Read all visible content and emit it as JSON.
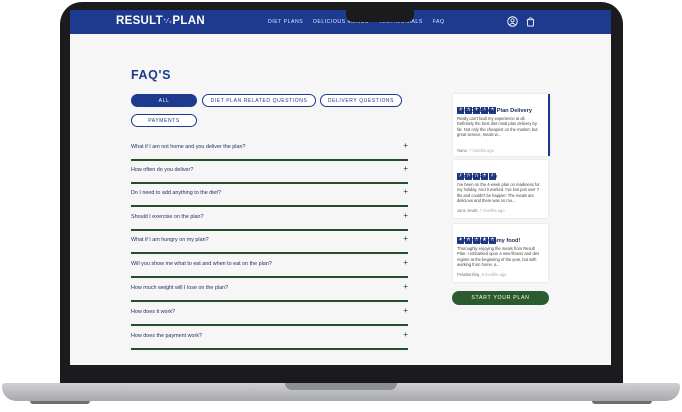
{
  "brand": {
    "logo_left": "RESULT",
    "logo_sep": "⁺⁄₊",
    "logo_right": "PLAN"
  },
  "nav": {
    "links": [
      "DIET PLANS",
      "DELICIOUS MENUS",
      "TESTIMONIALS",
      "FAQ"
    ]
  },
  "page": {
    "title": "FAQ'S"
  },
  "filters": [
    "ALL",
    "DIET PLAN RELATED QUESTIONS",
    "DELIVERY QUESTIONS",
    "PAYMENTS"
  ],
  "faqs": [
    "What if I am not home and you deliver the plan?",
    "How often do you deliver?",
    "Do I need to add anything to the diet?",
    "Should I exercise on the plan?",
    "What if I am hungry on my plan?",
    "Will you show me what to eat and when to eat on the plan?",
    "How much weight will I lose on the plan?",
    "How does it work?",
    "How does the payment work?"
  ],
  "faq_expand_symbol": "+",
  "reviews": [
    {
      "stars": "★",
      "rating": 5,
      "title": "Best Diet Meal Plan Delivery",
      "text": "Really can't fault my experience at all. Definitely the best diet meal plan delivery by far. Not only the cheapest on the market, but great service, meals w...",
      "author": "Nana",
      "ago": "7 months ago"
    },
    {
      "stars": "★",
      "rating": 5,
      "title": "Worked For Me",
      "text": "I've been on the 4-week plan on readiness for my holiday. And it worked. I've lost just over 7 lbs and couldn't be happier. The meals are delicious and there was so mu...",
      "author": "Jane Jewitt",
      "ago": "7 months ago"
    },
    {
      "stars": "★",
      "rating": 5,
      "title": "Scrummy, yummy food!",
      "text": "Thoroughly enjoying the meals from Result Plan. I embarked upon a new fitness and diet regime at the beginning of the year, but with working from home, a...",
      "author": "PetaBartling",
      "ago": "8 months ago"
    }
  ],
  "cta": {
    "label": "START YOUR PLAN"
  },
  "colors": {
    "navy": "#1d3a8e",
    "green": "#2b5b2f"
  }
}
